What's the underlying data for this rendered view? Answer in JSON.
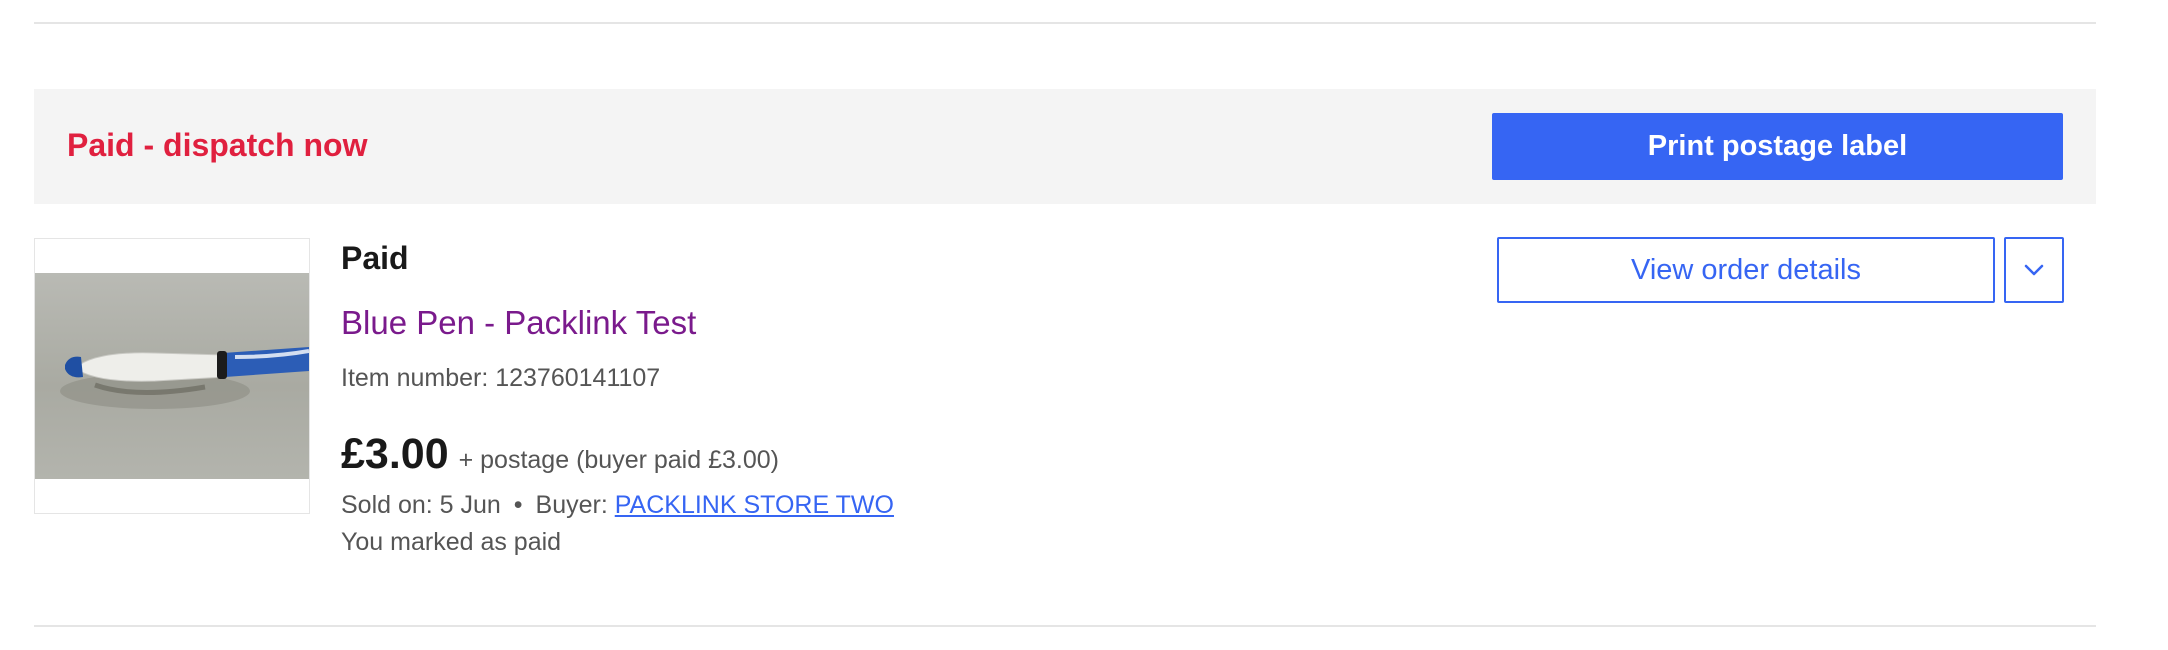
{
  "status_bar": {
    "status_text": "Paid - dispatch now",
    "print_label_button": "Print postage label"
  },
  "order": {
    "item_status": "Paid",
    "title": "Blue Pen - Packlink Test",
    "item_number": "Item number: 123760141107",
    "price": "£3.00",
    "postage": "+ postage (buyer paid £3.00)",
    "sold_on": "Sold on: 5 Jun",
    "separator": "•",
    "buyer_label": "Buyer:",
    "buyer_name": "PACKLINK STORE TWO",
    "payment_note": "You marked as paid",
    "thumbnail_icon": "blue-pen-photo"
  },
  "actions": {
    "view_order_details": "View order details",
    "more_actions_icon": "chevron-down-icon"
  },
  "colors": {
    "status_red": "#e0203f",
    "primary_blue": "#3665f3",
    "title_purple": "#7a1a8c",
    "panel_grey": "#f4f4f4"
  }
}
